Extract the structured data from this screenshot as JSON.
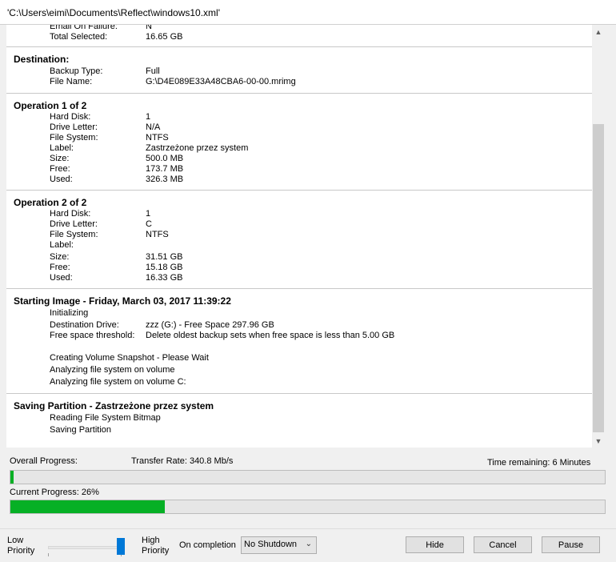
{
  "window": {
    "title": "'C:\\Users\\eimi\\Documents\\Reflect\\windows10.xml'"
  },
  "summary": {
    "rows": [
      {
        "key": "Email On Failure:",
        "value": "N"
      },
      {
        "key": "Total Selected:",
        "value": "16.65 GB"
      }
    ]
  },
  "destination": {
    "heading": "Destination:",
    "rows": [
      {
        "key": "Backup Type:",
        "value": "Full"
      },
      {
        "key": "File Name:",
        "value": "G:\\D4E089E33A48CBA6-00-00.mrimg"
      }
    ]
  },
  "op1": {
    "heading": "Operation 1 of 2",
    "rows": [
      {
        "key": "Hard Disk:",
        "value": "1"
      },
      {
        "key": "Drive Letter:",
        "value": "N/A"
      },
      {
        "key": "File System:",
        "value": "NTFS"
      },
      {
        "key": "Label:",
        "value": "Zastrzeżone przez system"
      },
      {
        "key": "Size:",
        "value": "500.0 MB"
      },
      {
        "key": "Free:",
        "value": "173.7 MB"
      },
      {
        "key": "Used:",
        "value": "326.3 MB"
      }
    ]
  },
  "op2": {
    "heading": "Operation 2 of 2",
    "rows": [
      {
        "key": "Hard Disk:",
        "value": "1"
      },
      {
        "key": "Drive Letter:",
        "value": "C"
      },
      {
        "key": "File System:",
        "value": "NTFS"
      },
      {
        "key": "Label:",
        "value": ""
      },
      {
        "key": "Size:",
        "value": "31.51 GB"
      },
      {
        "key": "Free:",
        "value": "15.18 GB"
      },
      {
        "key": "Used:",
        "value": "16.33 GB"
      }
    ]
  },
  "imaging": {
    "heading": "Starting Image - Friday, March 03, 2017 11:39:22",
    "status": "Initializing",
    "rows": [
      {
        "key": "Destination Drive:",
        "value": "zzz (G:) - Free Space 297.96 GB"
      },
      {
        "key": "Free space threshold:",
        "value": "Delete oldest backup sets when free space is less than 5.00 GB"
      }
    ],
    "lines": [
      "Creating Volume Snapshot - Please Wait",
      "Analyzing file system on volume",
      "Analyzing file system on volume C:"
    ]
  },
  "saving": {
    "heading": "Saving Partition - Zastrzeżone przez system",
    "lines": [
      "Reading File System Bitmap",
      "Saving Partition"
    ]
  },
  "progress": {
    "overall_label": "Overall Progress:",
    "transfer_rate": "Transfer Rate: 340.8 Mb/s",
    "time_remaining": "Time remaining: 6 Minutes",
    "overall_percent": 0.6,
    "current_label": "Current Progress:  26%",
    "current_percent": 26
  },
  "bottom": {
    "low_priority": "Low\nPriority",
    "high_priority": "High\nPriority",
    "priority_level": 1.0,
    "on_completion_label": "On completion",
    "on_completion_value": "No Shutdown",
    "hide_label": "Hide",
    "cancel_label": "Cancel",
    "pause_label": "Pause"
  },
  "colors": {
    "progress_fill": "#06b025",
    "slider_thumb": "#0078d7"
  }
}
